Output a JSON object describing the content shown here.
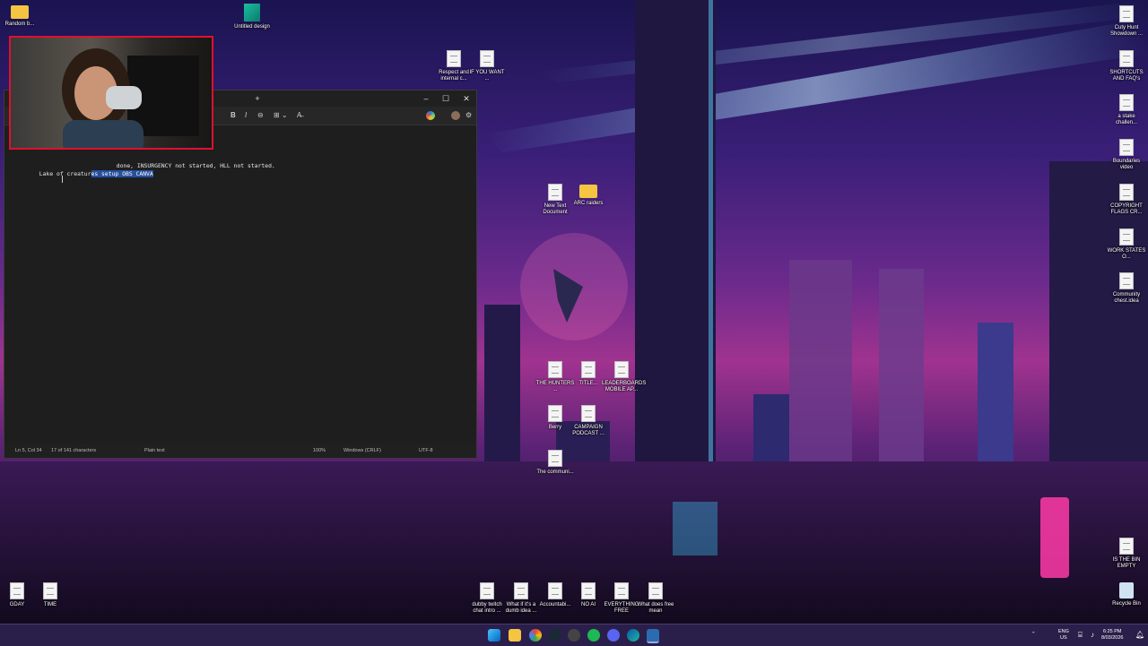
{
  "desktop_icons": [
    {
      "label": "Random b...",
      "kind": "folder"
    },
    {
      "label": "Untitled design",
      "kind": "canva"
    },
    {
      "label": "Respect and internal c...",
      "kind": "doc"
    },
    {
      "label": "IF YOU WANT ...",
      "kind": "doc"
    },
    {
      "label": "Cuty Hunt Showdown ...",
      "kind": "doc"
    },
    {
      "label": "SHORTCUTS AND FAQ's",
      "kind": "doc"
    },
    {
      "label": "a stake challen...",
      "kind": "doc"
    },
    {
      "label": "Boundaries video",
      "kind": "doc"
    },
    {
      "label": "COPYRIGHT FLAGS CR...",
      "kind": "doc"
    },
    {
      "label": "WORK STATES O...",
      "kind": "doc"
    },
    {
      "label": "Community chest.idea",
      "kind": "doc"
    },
    {
      "label": "New Text Document",
      "kind": "doc"
    },
    {
      "label": "ARC raiders",
      "kind": "folder"
    },
    {
      "label": "THE HUNTERS ...",
      "kind": "doc"
    },
    {
      "label": "TITLE...",
      "kind": "doc"
    },
    {
      "label": "LEADERBOARDS MOBILE AP...",
      "kind": "doc"
    },
    {
      "label": "Berry",
      "kind": "doc"
    },
    {
      "label": "CAMPAIGN PODCAST ...",
      "kind": "doc"
    },
    {
      "label": "The communi...",
      "kind": "doc"
    },
    {
      "label": "IS THE BIN EMPTY",
      "kind": "doc"
    },
    {
      "label": "Recycle Bin",
      "kind": "bin"
    },
    {
      "label": "GDAY",
      "kind": "doc"
    },
    {
      "label": "TIME",
      "kind": "doc"
    },
    {
      "label": "dubby twitch chat intro ...",
      "kind": "doc"
    },
    {
      "label": "What if it's a dumb idea ...",
      "kind": "doc"
    },
    {
      "label": "Accountabi...",
      "kind": "doc"
    },
    {
      "label": "NO AI",
      "kind": "doc"
    },
    {
      "label": "EVERYTHING FREE",
      "kind": "doc"
    },
    {
      "label": "What does free mean",
      "kind": "doc"
    }
  ],
  "notepad": {
    "tab_add": "+",
    "window_controls": {
      "minimize": "–",
      "maximize": "☐",
      "close": "✕"
    },
    "toolbar": {
      "bold": "B",
      "italic": "I",
      "link": "⊖",
      "table": "⊞ ⌄",
      "clear": "A̶",
      "settings": "⚙"
    },
    "lines": [
      {
        "pre": "",
        "sel": "",
        "post": "done, INSURGENCY not started, HLL not started."
      },
      {
        "pre": "Lake of creatur",
        "sel": "es setup OBS CANVA",
        "post": ""
      }
    ],
    "status": {
      "position": "Ln 5, Col 34",
      "chars": "17 of 141 characters",
      "format": "Plain text",
      "zoom": "100%",
      "eol": "Windows (CRLF)",
      "encoding": "UTF-8"
    }
  },
  "taskbar": {
    "language": "ENG",
    "region": "US",
    "time": "6:25 PM",
    "date": "8/03/2026"
  }
}
